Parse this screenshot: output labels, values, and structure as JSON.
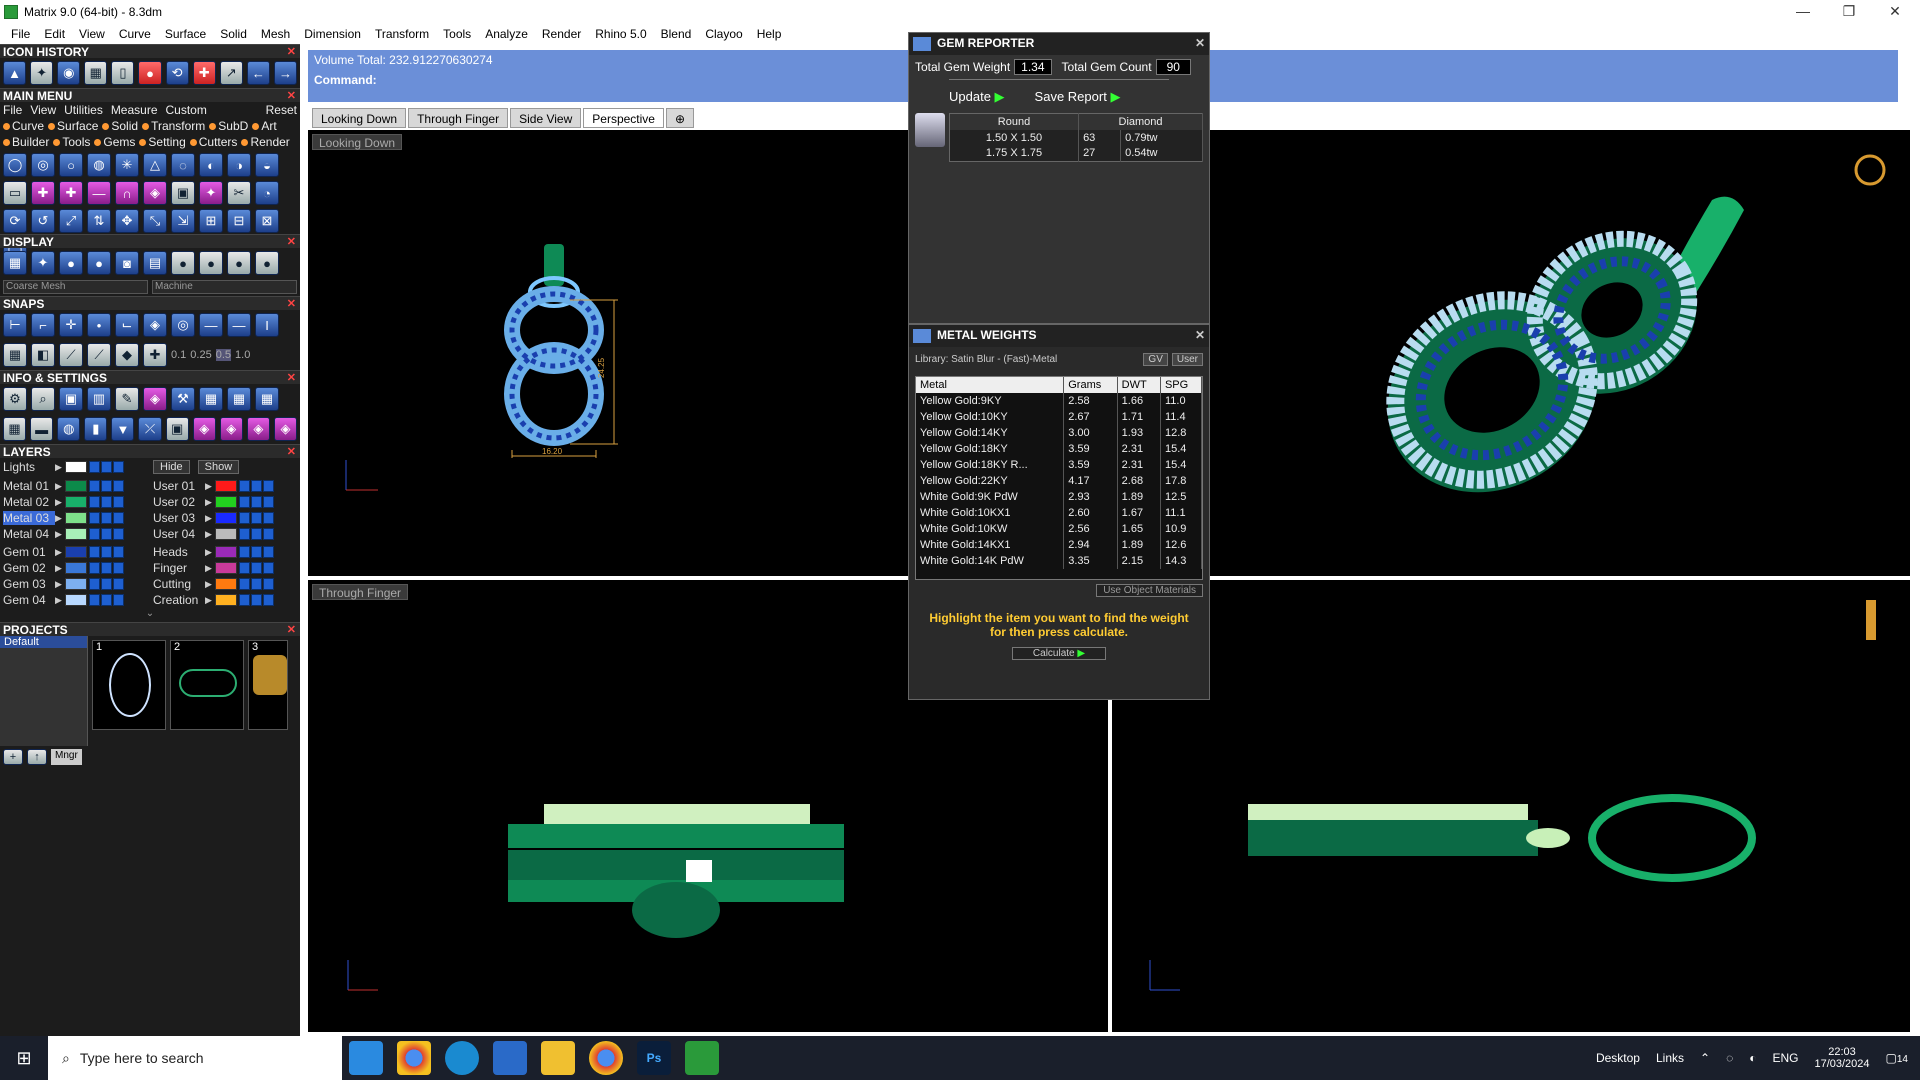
{
  "window": {
    "title": "Matrix 9.0 (64-bit) - 8.3dm"
  },
  "menubar": [
    "File",
    "Edit",
    "View",
    "Curve",
    "Surface",
    "Solid",
    "Mesh",
    "Dimension",
    "Transform",
    "Tools",
    "Analyze",
    "Render",
    "Rhino 5.0",
    "Blend",
    "Clayoo",
    "Help"
  ],
  "left": {
    "icon_history": "ICON HISTORY",
    "main_menu": "MAIN MENU",
    "main_menu_row1": [
      "File",
      "View",
      "Utilities",
      "Measure",
      "Custom",
      "Reset"
    ],
    "main_menu_row2": [
      "Curve",
      "Surface",
      "Solid",
      "Transform",
      "SubD",
      "Art"
    ],
    "main_menu_row3": [
      "Builder",
      "Tools",
      "Gems",
      "Setting",
      "Cutters",
      "Render"
    ],
    "display": "DISPLAY",
    "display_dd1": "Coarse Mesh",
    "display_dd2": "Machine",
    "snaps": "SNAPS",
    "snap_values": [
      "0.1",
      "0.25",
      "0.5",
      "1.0"
    ],
    "info": "INFO & SETTINGS",
    "layers": "LAYERS",
    "lights": "Lights",
    "hide": "Hide",
    "show": "Show",
    "layer_left": [
      {
        "name": "Metal 01",
        "color": "#0c8a4a"
      },
      {
        "name": "Metal 02",
        "color": "#18b06a"
      },
      {
        "name": "Metal 03",
        "color": "#7ee08a"
      },
      {
        "name": "Metal 04",
        "color": "#a8f0b8"
      },
      {
        "name": "Gem 01",
        "color": "#1a3fae"
      },
      {
        "name": "Gem 02",
        "color": "#3a78d8"
      },
      {
        "name": "Gem 03",
        "color": "#7db0f0"
      },
      {
        "name": "Gem 04",
        "color": "#b8d8ff"
      }
    ],
    "layer_right": [
      {
        "name": "User 01",
        "color": "#ff1a1a"
      },
      {
        "name": "User 02",
        "color": "#22d01f"
      },
      {
        "name": "User 03",
        "color": "#1a2aff"
      },
      {
        "name": "User 04",
        "color": "#bbbbbb"
      },
      {
        "name": "Heads",
        "color": "#9a2ab8"
      },
      {
        "name": "Finger",
        "color": "#c83a9a"
      },
      {
        "name": "Cutting",
        "color": "#ff7a10"
      },
      {
        "name": "Creation",
        "color": "#ffb020"
      }
    ],
    "projects": "PROJECTS",
    "project_default": "Default",
    "project_nums": [
      "1",
      "2",
      "3"
    ],
    "mngr": "Mngr"
  },
  "command": {
    "volume": "Volume Total: 232.912270630274",
    "command_label": "Command:"
  },
  "tabs": [
    "Looking Down",
    "Through Finger",
    "Side View",
    "Perspective"
  ],
  "viewport_labels": {
    "top_left": "Looking Down",
    "bottom_left": "Through Finger"
  },
  "dimensions": {
    "height": "24.25",
    "width": "16.20"
  },
  "gem_reporter": {
    "title": "GEM REPORTER",
    "total_weight_label": "Total Gem Weight",
    "total_weight": "1.34",
    "total_count_label": "Total Gem Count",
    "total_count": "90",
    "update": "Update",
    "save_report": "Save Report",
    "cols": [
      "Round",
      "Diamond"
    ],
    "rows": [
      {
        "size": "1.50 X 1.50",
        "count": "63",
        "tw": "0.79tw"
      },
      {
        "size": "1.75 X 1.75",
        "count": "27",
        "tw": "0.54tw"
      }
    ]
  },
  "metal_weights": {
    "title": "METAL WEIGHTS",
    "library": "Library: Satin Blur - (Fast)-Metal",
    "gv": "GV",
    "user": "User",
    "headers": [
      "Metal",
      "Grams",
      "DWT",
      "SPG"
    ],
    "rows": [
      [
        "Yellow Gold:9KY",
        "2.58",
        "1.66",
        "11.0"
      ],
      [
        "Yellow Gold:10KY",
        "2.67",
        "1.71",
        "11.4"
      ],
      [
        "Yellow Gold:14KY",
        "3.00",
        "1.93",
        "12.8"
      ],
      [
        "Yellow Gold:18KY",
        "3.59",
        "2.31",
        "15.4"
      ],
      [
        "Yellow Gold:18KY R...",
        "3.59",
        "2.31",
        "15.4"
      ],
      [
        "Yellow Gold:22KY",
        "4.17",
        "2.68",
        "17.8"
      ],
      [
        "White Gold:9K PdW",
        "2.93",
        "1.89",
        "12.5"
      ],
      [
        "White Gold:10KX1",
        "2.60",
        "1.67",
        "11.1"
      ],
      [
        "White Gold:10KW",
        "2.56",
        "1.65",
        "10.9"
      ],
      [
        "White Gold:14KX1",
        "2.94",
        "1.89",
        "12.6"
      ],
      [
        "White Gold:14K PdW",
        "3.35",
        "2.15",
        "14.3"
      ]
    ],
    "use_object_materials": "Use Object Materials",
    "hint": "Highlight the item you want to find the weight for then press calculate.",
    "calculate": "Calculate"
  },
  "taskbar": {
    "search_placeholder": "Type here to search",
    "desktop": "Desktop",
    "links": "Links",
    "lang": "ENG",
    "time": "22:03",
    "date": "17/03/2024",
    "notif": "14"
  }
}
